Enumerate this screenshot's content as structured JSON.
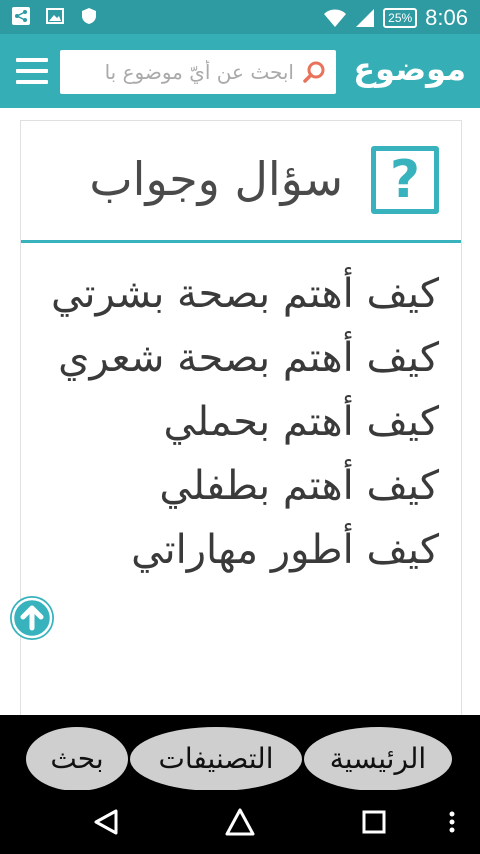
{
  "status_bar": {
    "battery": "25%",
    "time": "8:06",
    "icons": [
      "share-icon",
      "image-icon",
      "shield-icon",
      "wifi-icon",
      "signal-icon",
      "battery-icon"
    ]
  },
  "header": {
    "logo": "موضوع",
    "search_placeholder": "ابحث عن أيّ موضوع با",
    "accent_color": "#36aeb6"
  },
  "card": {
    "icon_glyph": "?",
    "title": "سؤال وجواب",
    "questions": [
      "كيف أهتم بصحة بشرتي",
      "كيف أهتم بصحة شعري",
      "كيف أهتم بحملي",
      "كيف أهتم بطفلي",
      "كيف أطور مهاراتي"
    ]
  },
  "bottom_nav": {
    "home": "الرئيسية",
    "categories": "التصنيفات",
    "search": "بحث"
  }
}
